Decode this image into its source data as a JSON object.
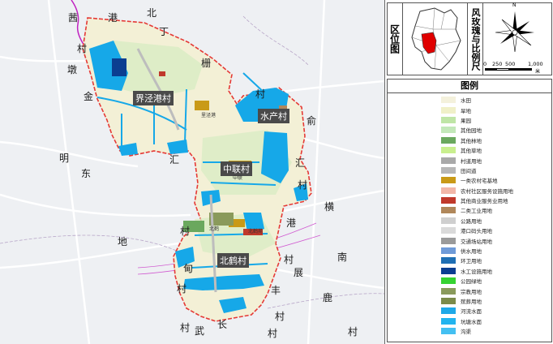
{
  "map": {
    "surrounding_labels": [
      "茜",
      "港",
      "北",
      "丁",
      "村",
      "墩",
      "金",
      "栅",
      "村",
      "俞",
      "明",
      "汇",
      "东",
      "汇",
      "村",
      "横",
      "港",
      "村",
      "地",
      "南",
      "村",
      "甸",
      "村",
      "展",
      "丰",
      "鹿",
      "村",
      "村",
      "武",
      "长",
      "村",
      "村"
    ],
    "village_labels": [
      "界泾港村",
      "水产村",
      "中联村",
      "北鹤村"
    ],
    "place_labels": [
      "里泾港",
      "中联",
      "北鹤",
      "北鹤苑"
    ],
    "colors": {
      "boundary": "#e53935",
      "water": "#16a8e8",
      "farmland": "#f3f0d6",
      "village": "#d9ecc4",
      "outside": "#eef0f3"
    }
  },
  "location_panel": {
    "title": "区位图",
    "scale_title": "风玫瑰与比例尺",
    "scale_ticks": [
      "0",
      "250",
      "500",
      "1,000"
    ],
    "scale_unit": "米",
    "north_label": "N"
  },
  "legend": {
    "title": "图例",
    "items": [
      {
        "label": "水田",
        "color": "#f4f1dc"
      },
      {
        "label": "旱地",
        "color": "#f0f0c8"
      },
      {
        "label": "果园",
        "color": "#bfe5a6"
      },
      {
        "label": "其他园地",
        "color": "#c3e8b9"
      },
      {
        "label": "其他林地",
        "color": "#6aa85e"
      },
      {
        "label": "其他草地",
        "color": "#c9ef8e"
      },
      {
        "label": "村道用地",
        "color": "#a9a9a9"
      },
      {
        "label": "田间道",
        "color": "#b7b7b7"
      },
      {
        "label": "一类农村宅基地",
        "color": "#c99a17"
      },
      {
        "label": "农村社区服务设施用地",
        "color": "#f2b7a8"
      },
      {
        "label": "其他商业服务业用地",
        "color": "#c0392b"
      },
      {
        "label": "二类工业用地",
        "color": "#b0875a"
      },
      {
        "label": "公路用地",
        "color": "#cfcfcf"
      },
      {
        "label": "港口码头用地",
        "color": "#dadada"
      },
      {
        "label": "交通场站用地",
        "color": "#9a9a9a"
      },
      {
        "label": "供水用地",
        "color": "#6f9bd8"
      },
      {
        "label": "环卫用地",
        "color": "#1f6fb4"
      },
      {
        "label": "水工设施用地",
        "color": "#0b3e91"
      },
      {
        "label": "公园绿地",
        "color": "#36d331"
      },
      {
        "label": "宗教用地",
        "color": "#8a9a5b"
      },
      {
        "label": "殡葬用地",
        "color": "#7b8b4a"
      },
      {
        "label": "河流水面",
        "color": "#1ea9e8"
      },
      {
        "label": "坑塘水面",
        "color": "#22b4ef"
      },
      {
        "label": "沟渠",
        "color": "#44c0f2"
      }
    ]
  }
}
